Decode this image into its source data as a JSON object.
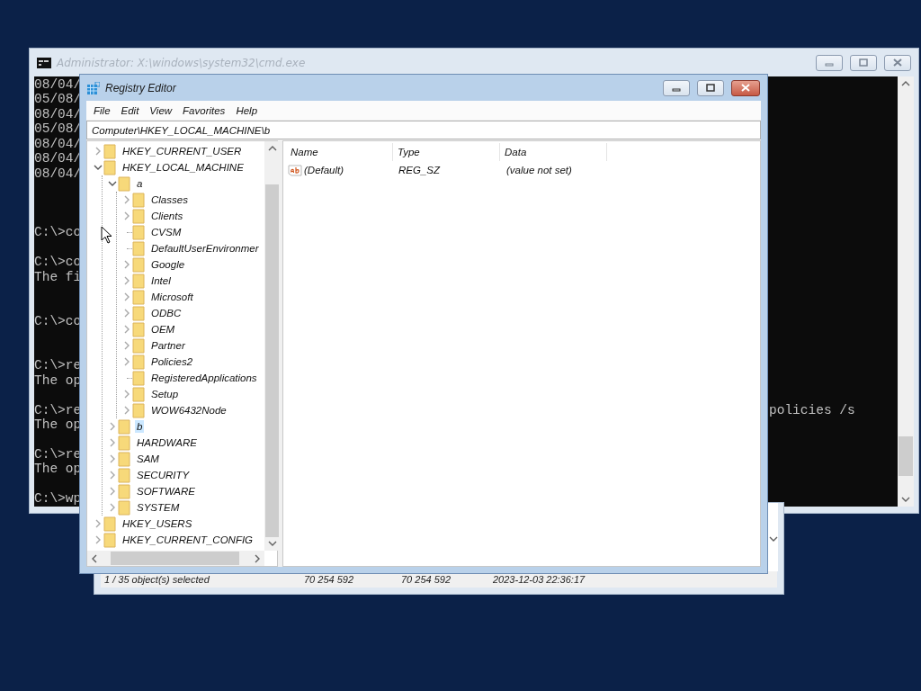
{
  "console_window": {
    "title": "Administrator: X:\\windows\\system32\\cmd.exe",
    "active": false,
    "lines": [
      {
        "kind": "text",
        "text": "08/04/"
      },
      {
        "kind": "text",
        "text": "05/08/"
      },
      {
        "kind": "text",
        "text": "08/04/"
      },
      {
        "kind": "text",
        "text": "05/08/"
      },
      {
        "kind": "text",
        "text": "08/04/"
      },
      {
        "kind": "text",
        "text": "08/04/"
      },
      {
        "kind": "text",
        "text": "08/04/"
      },
      {
        "kind": "blank"
      },
      {
        "kind": "blank"
      },
      {
        "kind": "blank"
      },
      {
        "kind": "text",
        "text": "C:\\>co"
      },
      {
        "kind": "blank"
      },
      {
        "kind": "text",
        "text": "C:\\>co"
      },
      {
        "kind": "text",
        "text": "The fi"
      },
      {
        "kind": "blank"
      },
      {
        "kind": "blank"
      },
      {
        "kind": "text",
        "text": "C:\\>co"
      },
      {
        "kind": "blank"
      },
      {
        "kind": "blank"
      },
      {
        "kind": "text",
        "text": "C:\\>re"
      },
      {
        "kind": "text",
        "text": "The op"
      },
      {
        "kind": "blank"
      },
      {
        "kind": "text",
        "text": "C:\\>re",
        "tail": "policies /s"
      },
      {
        "kind": "text",
        "text": "The op"
      },
      {
        "kind": "blank"
      },
      {
        "kind": "text",
        "text": "C:\\>re"
      },
      {
        "kind": "text",
        "text": "The op"
      },
      {
        "kind": "blank"
      },
      {
        "kind": "text",
        "text": "C:\\>wp"
      }
    ]
  },
  "file_window": {
    "status_bar": [
      "1 / 35 object(s) selected",
      "70 254 592",
      "70 254 592",
      "2023-12-03 22:36:17"
    ]
  },
  "registry_editor": {
    "title": "Registry Editor",
    "active": true,
    "menu": [
      "File",
      "Edit",
      "View",
      "Favorites",
      "Help"
    ],
    "address": "Computer\\HKEY_LOCAL_MACHINE\\b",
    "tree": [
      {
        "label": "HKEY_CURRENT_USER",
        "has_subkeys": true,
        "expanded": false,
        "selected": false
      },
      {
        "label": "HKEY_LOCAL_MACHINE",
        "has_subkeys": true,
        "expanded": true,
        "selected": false,
        "children": [
          {
            "label": "a",
            "has_subkeys": true,
            "expanded": true,
            "selected": false,
            "children": [
              {
                "label": "Classes",
                "has_subkeys": true,
                "expanded": false,
                "selected": false
              },
              {
                "label": "Clients",
                "has_subkeys": true,
                "expanded": false,
                "selected": false
              },
              {
                "label": "CVSM",
                "has_subkeys": false,
                "selected": false
              },
              {
                "label": "DefaultUserEnvironmer",
                "has_subkeys": false,
                "selected": false
              },
              {
                "label": "Google",
                "has_subkeys": true,
                "expanded": false,
                "selected": false
              },
              {
                "label": "Intel",
                "has_subkeys": true,
                "expanded": false,
                "selected": false
              },
              {
                "label": "Microsoft",
                "has_subkeys": true,
                "expanded": false,
                "selected": false
              },
              {
                "label": "ODBC",
                "has_subkeys": true,
                "expanded": false,
                "selected": false
              },
              {
                "label": "OEM",
                "has_subkeys": true,
                "expanded": false,
                "selected": false
              },
              {
                "label": "Partner",
                "has_subkeys": true,
                "expanded": false,
                "selected": false
              },
              {
                "label": "Policies2",
                "has_subkeys": true,
                "expanded": false,
                "selected": false
              },
              {
                "label": "RegisteredApplications",
                "has_subkeys": false,
                "selected": false
              },
              {
                "label": "Setup",
                "has_subkeys": true,
                "expanded": false,
                "selected": false
              },
              {
                "label": "WOW6432Node",
                "has_subkeys": true,
                "expanded": false,
                "selected": false
              }
            ]
          },
          {
            "label": "b",
            "has_subkeys": true,
            "expanded": false,
            "selected": true
          },
          {
            "label": "HARDWARE",
            "has_subkeys": true,
            "expanded": false,
            "selected": false
          },
          {
            "label": "SAM",
            "has_subkeys": true,
            "expanded": false,
            "selected": false
          },
          {
            "label": "SECURITY",
            "has_subkeys": true,
            "expanded": false,
            "selected": false
          },
          {
            "label": "SOFTWARE",
            "has_subkeys": true,
            "expanded": false,
            "selected": false
          },
          {
            "label": "SYSTEM",
            "has_subkeys": true,
            "expanded": false,
            "selected": false
          }
        ]
      },
      {
        "label": "HKEY_USERS",
        "has_subkeys": true,
        "expanded": false,
        "selected": false
      },
      {
        "label": "HKEY_CURRENT_CONFIG",
        "has_subkeys": true,
        "expanded": false,
        "selected": false
      }
    ],
    "columns": [
      "Name",
      "Type",
      "Data"
    ],
    "rows": [
      {
        "name": "(Default)",
        "type": "REG_SZ",
        "data": "(value not set)"
      }
    ]
  }
}
